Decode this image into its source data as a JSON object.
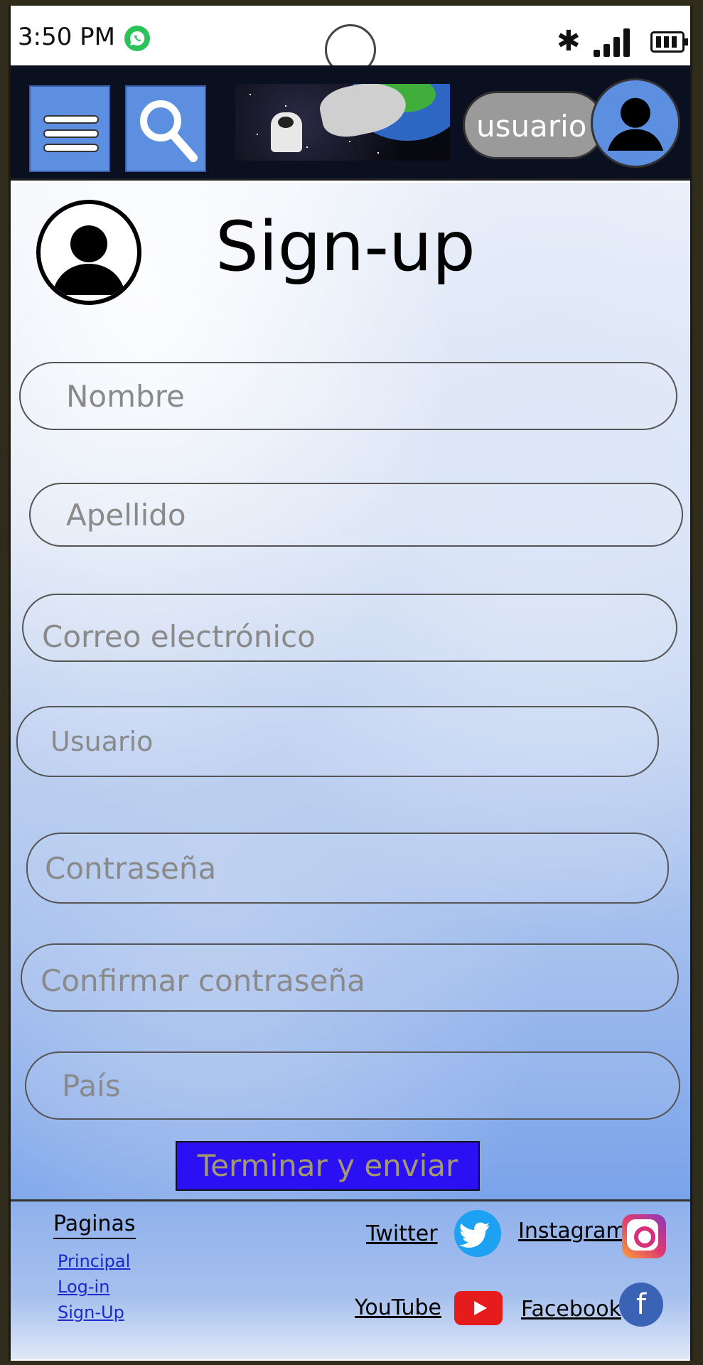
{
  "status_bar": {
    "time": "3:50 PM"
  },
  "header": {
    "user_label": "usuario"
  },
  "page": {
    "title": "Sign-up"
  },
  "form": {
    "fields": [
      {
        "placeholder": "Nombre"
      },
      {
        "placeholder": "Apellido"
      },
      {
        "placeholder": "Correo electrónico"
      },
      {
        "placeholder": "Usuario"
      },
      {
        "placeholder": "Contraseña"
      },
      {
        "placeholder": "Confirmar contraseña"
      },
      {
        "placeholder": "País"
      }
    ],
    "submit_label": "Terminar y enviar"
  },
  "footer": {
    "heading": "Paginas",
    "links": [
      "Principal",
      "Log-in",
      "Sign-Up"
    ],
    "social": {
      "twitter": "Twitter",
      "instagram": "Instagram",
      "youtube": "YouTube",
      "facebook": "Facebook"
    },
    "facebook_glyph": "f"
  },
  "icons": {
    "whatsapp": "whatsapp-icon",
    "bluetooth": "bluetooth-icon",
    "signal": "signal-icon",
    "battery": "battery-icon",
    "menu": "hamburger-menu-icon",
    "search": "search-icon",
    "avatar": "user-avatar-icon"
  },
  "colors": {
    "header_bg": "#0b1020",
    "button_blue": "#5d8fe0",
    "submit_bg": "#2a10f2",
    "submit_text": "#a39a6e"
  }
}
